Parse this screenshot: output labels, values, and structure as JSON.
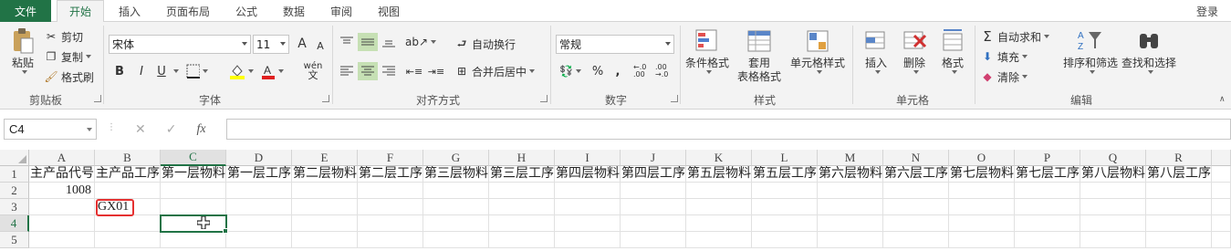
{
  "tabs": {
    "file": "文件",
    "items": [
      "开始",
      "插入",
      "页面布局",
      "公式",
      "数据",
      "审阅",
      "视图"
    ],
    "login": "登录"
  },
  "ribbon": {
    "clipboard": {
      "label": "剪贴板",
      "paste": "粘贴",
      "cut": "剪切",
      "copy": "复制",
      "format_painter": "格式刷"
    },
    "font": {
      "label": "字体",
      "font_name": "宋体",
      "font_size": "11",
      "bold": "B",
      "italic": "I",
      "underline": "U",
      "grow": "A",
      "shrink": "A",
      "phonetic": "wén"
    },
    "alignment": {
      "label": "对齐方式",
      "wrap_text": "自动换行",
      "merge_center": "合并后居中"
    },
    "number": {
      "label": "数字",
      "format": "常规",
      "percent": "%",
      "comma": ",",
      "inc_decimal": "←.0 .00",
      "dec_decimal": ".00 →.0"
    },
    "styles": {
      "label": "样式",
      "conditional": "条件格式",
      "table": "套用\n表格格式",
      "cell_styles": "单元格样式"
    },
    "cells": {
      "label": "单元格",
      "insert": "插入",
      "delete": "删除",
      "format": "格式"
    },
    "editing": {
      "label": "编辑",
      "autosum": "自动求和",
      "fill": "填充",
      "clear": "清除",
      "sort_filter": "排序和筛选",
      "find_select": "查找和选择"
    }
  },
  "formula_bar": {
    "name_box": "C4",
    "fx": "fx",
    "content": ""
  },
  "sheet": {
    "columns": [
      "A",
      "B",
      "C",
      "D",
      "E",
      "F",
      "G",
      "H",
      "I",
      "J",
      "K",
      "L",
      "M",
      "N",
      "O",
      "P",
      "Q",
      "R"
    ],
    "rows": [
      "1",
      "2",
      "3",
      "4",
      "5"
    ],
    "row1": [
      "主产品代号",
      "主产品工序",
      "第一层物料",
      "第一层工序",
      "第二层物料",
      "第二层工序",
      "第三层物料",
      "第三层工序",
      "第四层物料",
      "第四层工序",
      "第五层物料",
      "第五层工序",
      "第六层物料",
      "第六层工序",
      "第七层物料",
      "第七层工序",
      "第八层物料",
      "第八层工序特"
    ],
    "a2": "1008",
    "b3": "GX01",
    "active_cell": "C4"
  },
  "colors": {
    "accent": "#217346",
    "highlight_box": "#e53030"
  }
}
